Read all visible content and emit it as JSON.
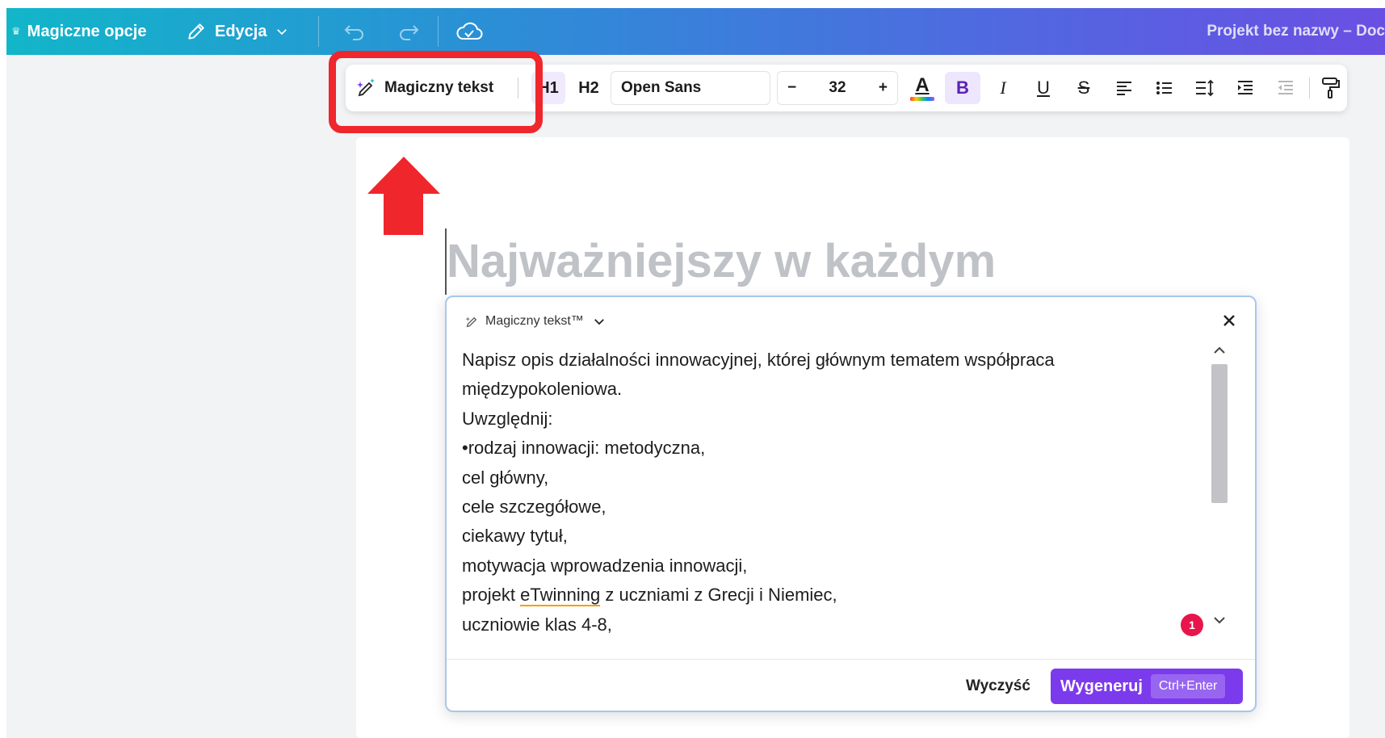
{
  "topbar": {
    "magic_options": "Magiczne opcje",
    "edit": "Edycja",
    "doc_title": "Projekt bez nazwy – Doc"
  },
  "toolbar": {
    "magic_text": "Magiczny tekst",
    "h1": "H1",
    "h2": "H2",
    "font": "Open Sans",
    "minus": "−",
    "font_size": "32",
    "plus": "+",
    "text_color_letter": "A",
    "bold": "B",
    "italic": "I",
    "underline": "U",
    "strike": "S"
  },
  "document": {
    "heading": "Najważniejszy w każdym"
  },
  "magic_panel": {
    "title": "Magiczny tekst™",
    "prompt_lines": [
      "Napisz opis działalności innowacyjnej, której głównym tematem współpraca",
      "międzypokoleniowa.",
      "Uwzględnij:",
      "•rodzaj innowacji: metodyczna,",
      "cel główny,",
      "cele szczegółowe,",
      "ciekawy tytuł,",
      "motywacja wprowadzenia innowacji,",
      "projekt eTwinning z uczniami z Grecji i Niemiec,",
      "uczniowie klas 4-8,"
    ],
    "badge_count": "1",
    "clear_label": "Wyczyść",
    "generate_label": "Wygeneruj",
    "shortcut": "Ctrl+Enter"
  },
  "colors": {
    "accent": "#7c3aed",
    "highlight_red": "#f0262d",
    "badge": "#e8154c"
  },
  "icons": [
    "crown-icon",
    "pencil-icon",
    "chevron-down-icon",
    "undo-icon",
    "redo-icon",
    "cloud-check-icon",
    "magic-wand-icon",
    "text-color-icon",
    "align-left-icon",
    "bullet-list-icon",
    "line-spacing-icon",
    "indent-icon",
    "outdent-icon",
    "paint-roller-icon",
    "close-icon",
    "chevron-up-icon"
  ]
}
